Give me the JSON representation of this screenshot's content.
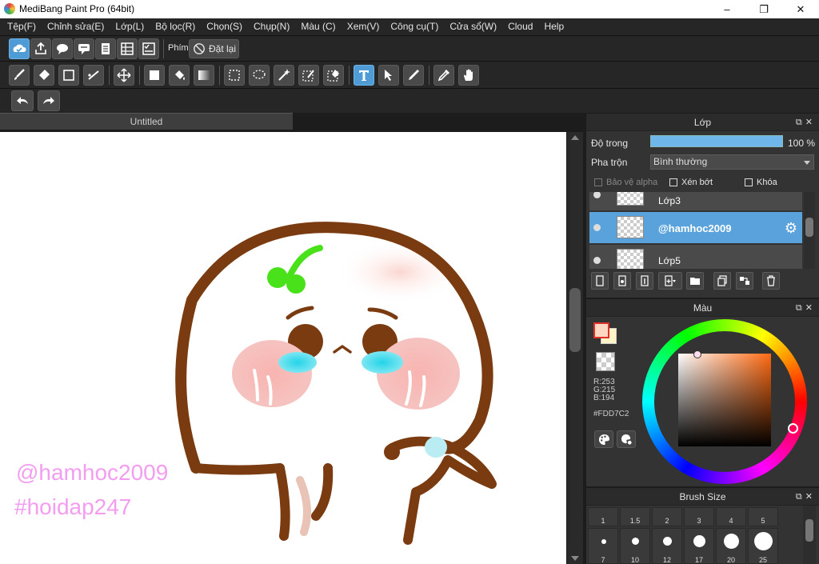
{
  "window": {
    "title": "MediBang Paint Pro (64bit)",
    "minimize": "–",
    "maximize": "❐",
    "close": "✕"
  },
  "menu": [
    "Tệp(F)",
    "Chỉnh sửa(E)",
    "Lớp(L)",
    "Bộ lọc(R)",
    "Chọn(S)",
    "Chụp(N)",
    "Màu (C)",
    "Xem(V)",
    "Công cụ(T)",
    "Cửa sổ(W)",
    "Cloud",
    "Help"
  ],
  "toolbar": {
    "phim_label": "Phím",
    "reset_label": "Đặt lại"
  },
  "document": {
    "tab_title": "Untitled",
    "watermark_1": "@hamhoc2009",
    "watermark_2": "#hoidap247"
  },
  "layer_panel": {
    "title": "Lớp",
    "opacity_label": "Độ trong",
    "opacity_value": "100 %",
    "opacity_fraction": 1.0,
    "blend_label": "Pha trộn",
    "blend_value": "Bình thường",
    "protect_alpha": "Bảo vệ alpha",
    "clipping": "Xén bớt",
    "lock": "Khóa",
    "layers": [
      {
        "name": "Lớp3",
        "selected": false
      },
      {
        "name": "@hamhoc2009",
        "selected": true
      },
      {
        "name": "Lớp5",
        "selected": false
      }
    ]
  },
  "color_panel": {
    "title": "Màu",
    "r": "R:253",
    "g": "G:215",
    "b": "B:194",
    "hex": "#FDD7C2",
    "foreground": "#FDD7C2"
  },
  "brush_panel": {
    "title": "Brush Size",
    "sizes_row1": [
      "1",
      "1.5",
      "2",
      "3",
      "4",
      "5"
    ],
    "sizes_row2": [
      "7",
      "10",
      "12",
      "17",
      "20",
      "25"
    ]
  },
  "colors": {
    "accent": "#4f9bd6",
    "selected_layer": "#5aa2db",
    "panel_bg": "#333333"
  }
}
